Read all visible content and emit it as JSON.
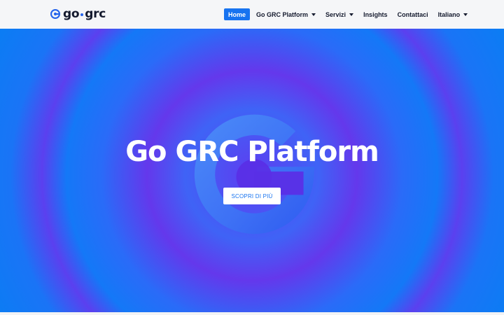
{
  "header": {
    "logo": {
      "part1": "go",
      "part2": "grc",
      "icon": "go-grc-logo-icon"
    },
    "nav": [
      {
        "label": "Home",
        "active": true,
        "dropdown": false
      },
      {
        "label": "Go GRC Platform",
        "active": false,
        "dropdown": true
      },
      {
        "label": "Servizi",
        "active": false,
        "dropdown": true
      },
      {
        "label": "Insights",
        "active": false,
        "dropdown": false
      },
      {
        "label": "Contattaci",
        "active": false,
        "dropdown": false
      },
      {
        "label": "Italiano",
        "active": false,
        "dropdown": true
      }
    ]
  },
  "hero": {
    "title": "Go GRC Platform",
    "button_label": "SCOPRI DI PIÙ"
  },
  "colors": {
    "accent": "#1773f0",
    "header_bg": "#f5f6f8",
    "hero_blue": "#0a7df4",
    "hero_violet": "#6438ec"
  }
}
